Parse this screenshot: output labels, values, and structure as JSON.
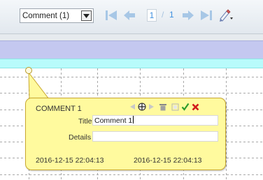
{
  "toolbar": {
    "comment_select_value": "Comment (1)",
    "icons": [
      "dropdown-arrow-icon",
      "first-page-icon",
      "previous-page-icon",
      "next-page-icon",
      "last-page-icon",
      "marker-tool-icon"
    ],
    "current_page": "1",
    "page_separator": "/",
    "total_pages": "1",
    "accent_color": "#3d8fe0"
  },
  "document": {
    "band_color": "#c4c8f0",
    "highlight_color": "#b8fbfb"
  },
  "comment": {
    "title": "COMMENT 1",
    "tools": [
      "previous-comment-icon",
      "move-icon",
      "next-comment-icon",
      "delete-icon",
      "copy-icon",
      "accept-icon",
      "reject-icon"
    ],
    "title_label": "Title",
    "title_value": "Comment 1",
    "details_label": "Details",
    "details_value": "",
    "created": "2016-12-15 22:04:13",
    "modified": "2016-12-15 22:04:13",
    "note_color": "#fffa9e"
  }
}
